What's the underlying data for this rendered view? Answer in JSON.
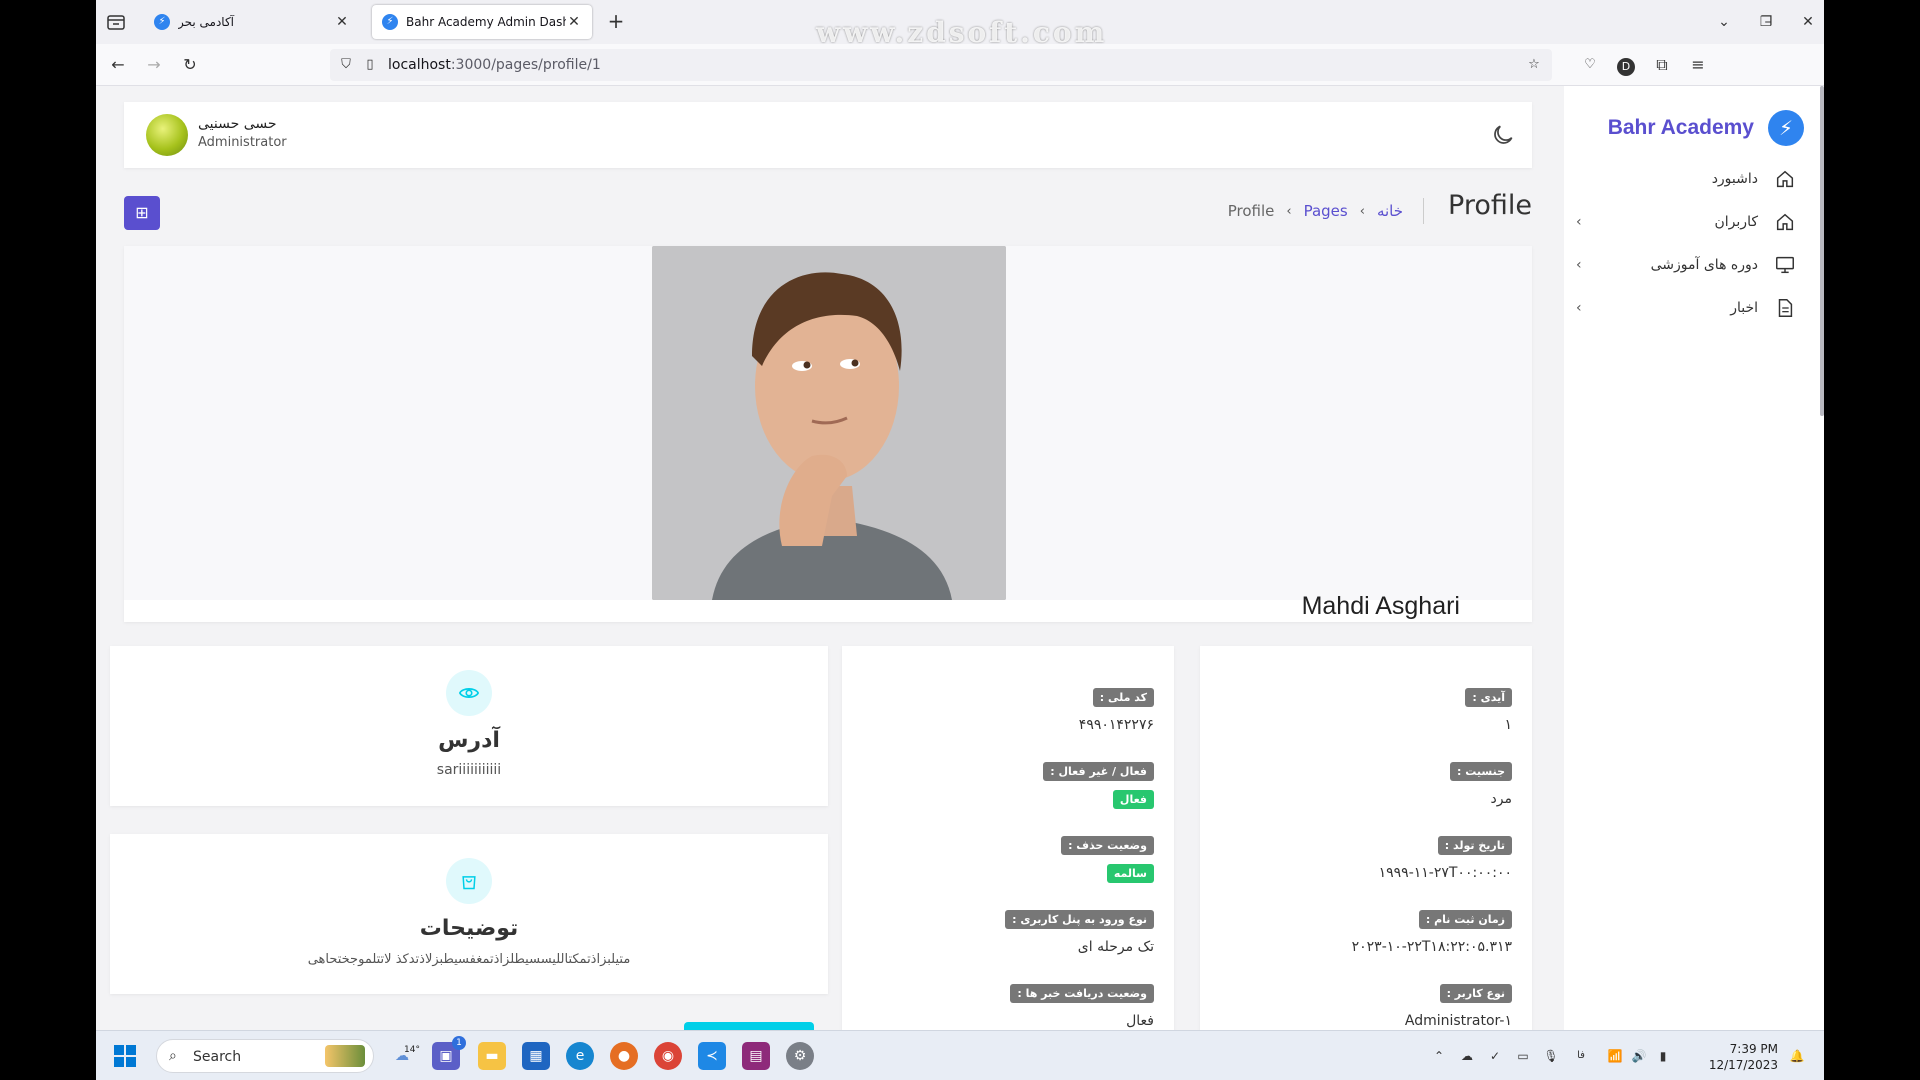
{
  "browser": {
    "tabs": [
      {
        "title": "آکادمی بحر"
      },
      {
        "title": "Bahr Academy Admin Dashboa"
      }
    ],
    "url_host": "localhost",
    "url_path": ":3000/pages/profile/1",
    "watermark": "www.zdsoft.com"
  },
  "sidebar": {
    "brand": "Bahr Academy",
    "items": [
      {
        "label": "داشبورد",
        "icon": "home-icon"
      },
      {
        "label": "کاربران",
        "icon": "home-icon"
      },
      {
        "label": "دوره های آموزشی",
        "icon": "monitor-icon"
      },
      {
        "label": "اخبار",
        "icon": "document-icon"
      }
    ]
  },
  "header": {
    "user_name": "حسی حسنیی",
    "user_role": "Administrator"
  },
  "breadcrumb": {
    "title": "Profile",
    "items": [
      "خانه",
      "Pages",
      "Profile"
    ]
  },
  "profile": {
    "name": "Mahdi Asghari"
  },
  "address_card": {
    "title": "آدرس",
    "text": "sariiiiiiiiiii"
  },
  "description_card": {
    "title": "توضیحات",
    "text": "متیلبزاذتمکتاللیسسیطلزاذتمغفسیطبزلاذتدکذ لاتتلموجختحاهی"
  },
  "info_left": [
    {
      "label": "آیدی :",
      "value": "۱"
    },
    {
      "label": "جنسیت :",
      "value": "مرد"
    },
    {
      "label": "تاریخ تولد :",
      "value": "۱۹۹۹-۱۱-۲۷T۰۰:۰۰:۰۰"
    },
    {
      "label": "زمان ثبت نام :",
      "value": "۲۰۲۳-۱۰-۲۲T۱۸:۲۲:۰۵.۳۱۳"
    },
    {
      "label": "نوع کاربر :",
      "value": "Administrator-۱"
    }
  ],
  "info_mid": [
    {
      "label": "کد ملی :",
      "value": "۴۹۹۰۱۴۲۲۷۶",
      "badge": false
    },
    {
      "label": "فعال / غیر فعال :",
      "value": "فعال",
      "badge": true
    },
    {
      "label": "وضعیت حذف :",
      "value": "سالمه",
      "badge": true
    },
    {
      "label": "نوع ورود به پنل کاربری :",
      "value": "تک مرحله ای",
      "badge": false
    },
    {
      "label": "وضعیت دریافت خبر ها :",
      "value": "فعال",
      "badge": false
    }
  ],
  "taskbar": {
    "search_label": "Search",
    "weather": "14°",
    "badge_count": "1",
    "lang": "فا",
    "time": "7:39 PM",
    "date": "12/17/2023"
  },
  "colors": {
    "accent": "#5a4fcf",
    "success": "#28c76f",
    "info": "#00cfe8",
    "label_pill": "#777777"
  }
}
